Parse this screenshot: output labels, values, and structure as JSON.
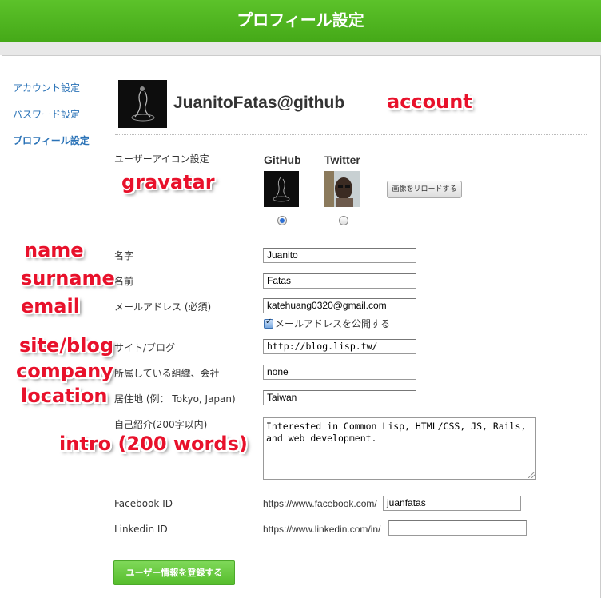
{
  "header": {
    "title": "プロフィール設定"
  },
  "sidebar": {
    "items": [
      {
        "label": "アカウント設定"
      },
      {
        "label": "パスワード設定"
      },
      {
        "label": "プロフィール設定"
      }
    ]
  },
  "account": {
    "name": "JuanitoFatas@github"
  },
  "icon_section": {
    "label": "ユーザーアイコン設定",
    "github_label": "GitHub",
    "twitter_label": "Twitter",
    "reload_button": "画像をリロードする"
  },
  "form": {
    "last_name_label": "名字",
    "last_name": "Juanito",
    "first_name_label": "名前",
    "first_name": "Fatas",
    "email_label": "メールアドレス (必須)",
    "email": "katehuang0320@gmail.com",
    "email_public_label": "メールアドレスを公開する",
    "site_label": "サイト/ブログ",
    "site": "http://blog.lisp.tw/",
    "org_label": "所属している組織、会社",
    "org": "none",
    "location_label": "居住地 (例： Tokyo, Japan)",
    "location": "Taiwan",
    "intro_label": "自己紹介(200字以内)",
    "intro": "Interested in Common Lisp, HTML/CSS, JS, Rails, and web development.",
    "facebook_label": "Facebook ID",
    "facebook_prefix": "https://www.facebook.com/",
    "facebook": "juanfatas",
    "linkedin_label": "Linkedin ID",
    "linkedin_prefix": "https://www.linkedin.com/in/",
    "linkedin": "",
    "submit": "ユーザー情報を登録する"
  },
  "annotations": {
    "account": "account",
    "gravatar": "gravatar",
    "name": "name",
    "surname": "surname",
    "email": "email",
    "site": "site/blog",
    "company": "company",
    "location": "location",
    "intro": "intro (200 words)"
  }
}
